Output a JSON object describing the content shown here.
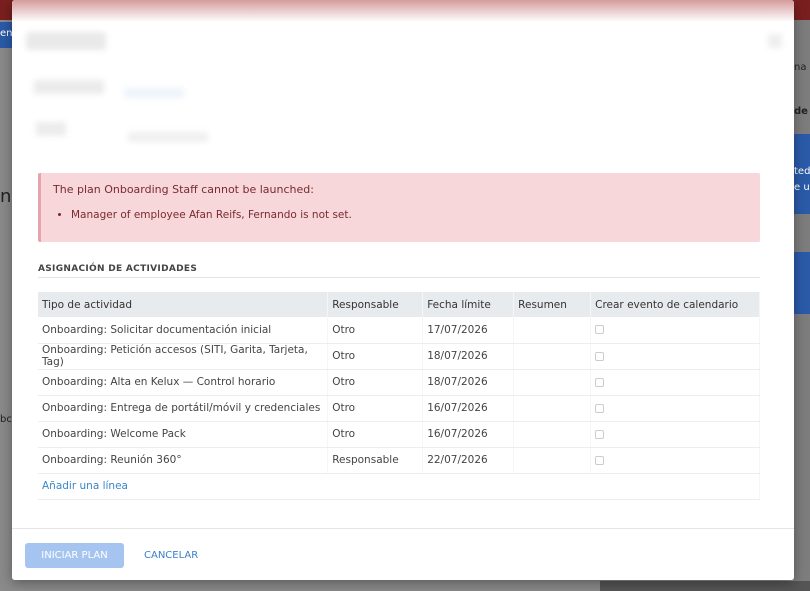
{
  "background": {
    "left_tab_text": "en",
    "left_text_1": "n",
    "left_text_2": "bcr",
    "right_text_1": "na r",
    "right_text_2": "de a",
    "right_text_3": "ted",
    "right_text_4": "e u"
  },
  "alert": {
    "title": "The plan Onboarding Staff cannot be launched:",
    "items": [
      "Manager of employee Afan Reifs, Fernando is not set."
    ]
  },
  "section": {
    "title": "ASIGNACIÓN DE ACTIVIDADES"
  },
  "table": {
    "headers": [
      "Tipo de actividad",
      "Responsable",
      "Fecha límite",
      "Resumen",
      "Crear evento de calendario"
    ],
    "rows": [
      {
        "type": "Onboarding: Solicitar documentación inicial",
        "responsible": "Otro",
        "deadline": "17/07/2026",
        "summary": "",
        "calendar": false
      },
      {
        "type": "Onboarding: Petición accesos (SITI, Garita, Tarjeta, Tag)",
        "responsible": "Otro",
        "deadline": "18/07/2026",
        "summary": "",
        "calendar": false
      },
      {
        "type": "Onboarding: Alta en Kelux — Control horario",
        "responsible": "Otro",
        "deadline": "18/07/2026",
        "summary": "",
        "calendar": false
      },
      {
        "type": "Onboarding: Entrega de portátil/móvil y credenciales",
        "responsible": "Otro",
        "deadline": "16/07/2026",
        "summary": "",
        "calendar": false
      },
      {
        "type": "Onboarding: Welcome Pack",
        "responsible": "Otro",
        "deadline": "16/07/2026",
        "summary": "",
        "calendar": false
      },
      {
        "type": "Onboarding: Reunión 360°",
        "responsible": "Responsable",
        "deadline": "22/07/2026",
        "summary": "",
        "calendar": false
      }
    ],
    "add_line": "Añadir una línea"
  },
  "footer": {
    "primary_label": "INICIAR PLAN",
    "cancel_label": "CANCELAR"
  },
  "colors": {
    "primary_button": "#a5c4f0",
    "alert_bg": "#f7d7da",
    "alert_text": "#7a2a30",
    "link": "#3a87c9"
  }
}
